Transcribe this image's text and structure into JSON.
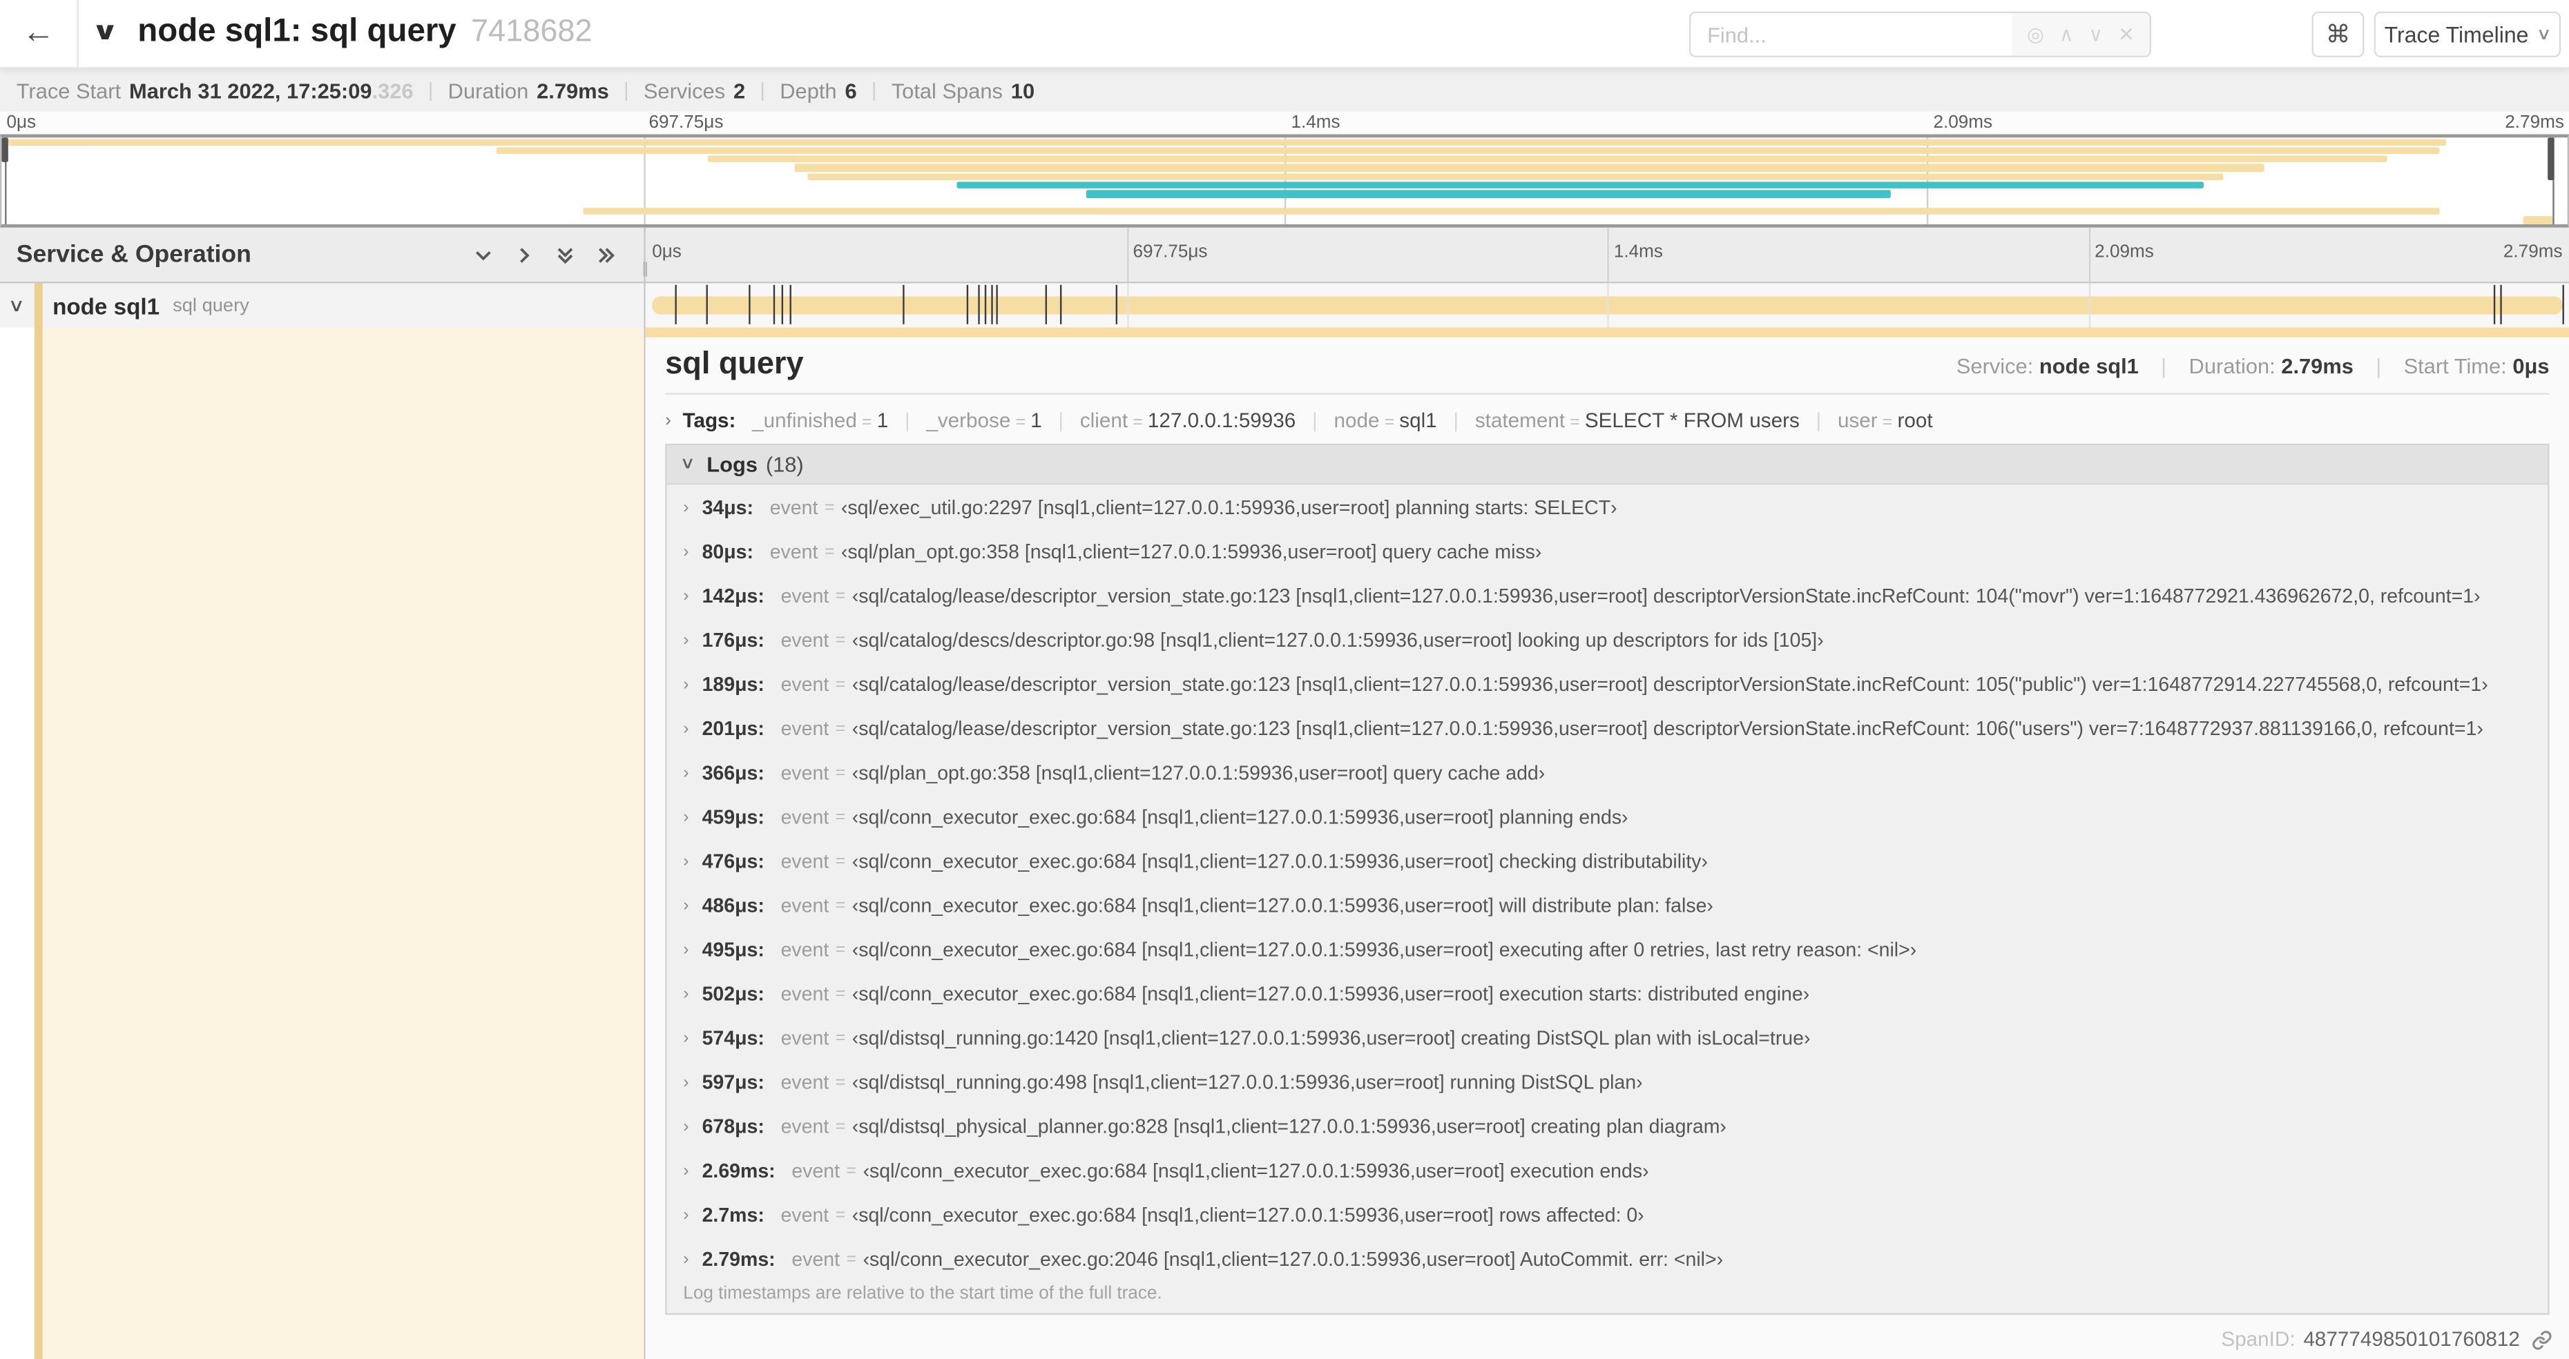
{
  "colors": {
    "tan": "#f6dda4",
    "tan_strip": "#eccf93",
    "cream": "#fcf3e0",
    "teal": "#3fc1c6"
  },
  "header": {
    "back": "←",
    "collapse_chevron": "∨",
    "title": "node sql1: sql query",
    "trace_id": "7418682",
    "find_placeholder": "Find...",
    "find_icons": [
      "◎",
      "∧",
      "∨",
      "✕"
    ],
    "shortcut_button": "⌘",
    "view_dropdown": "Trace Timeline",
    "view_dropdown_chevron": "∨"
  },
  "trace_info": {
    "start_label": "Trace Start",
    "start_value": "March 31 2022, 17:25:09",
    "start_suffix": ".326",
    "duration_label": "Duration",
    "duration_value": "2.79ms",
    "services_label": "Services",
    "services_value": "2",
    "depth_label": "Depth",
    "depth_value": "6",
    "spans_label": "Total Spans",
    "spans_value": "10",
    "separator": "|"
  },
  "timeline": {
    "total_us": 2790,
    "ticks": [
      {
        "label": "0μs",
        "pos": 0
      },
      {
        "label": "697.75μs",
        "pos": 25
      },
      {
        "label": "1.4ms",
        "pos": 50
      },
      {
        "label": "2.09ms",
        "pos": 75
      },
      {
        "label": "2.79ms",
        "pos": 100
      }
    ],
    "gridlines": [
      25,
      50,
      75
    ]
  },
  "minimap": {
    "spans": [
      {
        "row": 0,
        "start": 0,
        "end": 95.3,
        "color": "tan"
      },
      {
        "row": 1,
        "start": 19.3,
        "end": 95.0,
        "color": "tan"
      },
      {
        "row": 2,
        "start": 27.5,
        "end": 93.0,
        "color": "tan"
      },
      {
        "row": 3,
        "start": 30.9,
        "end": 88.2,
        "color": "tan"
      },
      {
        "row": 4,
        "start": 31.4,
        "end": 86.6,
        "color": "tan"
      },
      {
        "row": 5,
        "start": 37.2,
        "end": 85.8,
        "color": "teal"
      },
      {
        "row": 6,
        "start": 42.3,
        "end": 73.6,
        "color": "teal"
      },
      {
        "row": 8,
        "start": 22.7,
        "end": 95.0,
        "color": "tan"
      },
      {
        "row": 9,
        "start": 98.3,
        "end": 99.4,
        "color": "tan"
      }
    ]
  },
  "left_panel": {
    "header": "Service & Operation",
    "grip": "∥",
    "row": {
      "chevron": "∨",
      "service": "node sql1",
      "operation": "sql query"
    }
  },
  "detail": {
    "operation_title": "sql query",
    "service_label": "Service:",
    "service_value": "node sql1",
    "duration_label": "Duration:",
    "duration_value": "2.79ms",
    "start_label": "Start Time:",
    "start_value": "0μs",
    "meta_separator": "|",
    "tags_chevron": "›",
    "tags_label": "Tags:",
    "tags": [
      {
        "key": "_unfinished",
        "value": "1"
      },
      {
        "key": "_verbose",
        "value": "1"
      },
      {
        "key": "client",
        "value": "127.0.0.1:59936"
      },
      {
        "key": "node",
        "value": "sql1"
      },
      {
        "key": "statement",
        "value": "SELECT * FROM users"
      },
      {
        "key": "user",
        "value": "root"
      }
    ],
    "logs_chevron": "∨",
    "logs_label": "Logs",
    "logs_count": "(18)",
    "log_field": "event",
    "logs": [
      {
        "time": "34μs:",
        "t_us": 34,
        "value": "‹sql/exec_util.go:2297 [nsql1,client=127.0.0.1:59936,user=root] planning starts: SELECT›"
      },
      {
        "time": "80μs:",
        "t_us": 80,
        "value": "‹sql/plan_opt.go:358 [nsql1,client=127.0.0.1:59936,user=root] query cache miss›"
      },
      {
        "time": "142μs:",
        "t_us": 142,
        "value": "‹sql/catalog/lease/descriptor_version_state.go:123 [nsql1,client=127.0.0.1:59936,user=root] descriptorVersionState.incRefCount: 104(\"movr\") ver=1:1648772921.436962672,0, refcount=1›"
      },
      {
        "time": "176μs:",
        "t_us": 176,
        "value": "‹sql/catalog/descs/descriptor.go:98 [nsql1,client=127.0.0.1:59936,user=root] looking up descriptors for ids [105]›"
      },
      {
        "time": "189μs:",
        "t_us": 189,
        "value": "‹sql/catalog/lease/descriptor_version_state.go:123 [nsql1,client=127.0.0.1:59936,user=root] descriptorVersionState.incRefCount: 105(\"public\") ver=1:1648772914.227745568,0, refcount=1›"
      },
      {
        "time": "201μs:",
        "t_us": 201,
        "value": "‹sql/catalog/lease/descriptor_version_state.go:123 [nsql1,client=127.0.0.1:59936,user=root] descriptorVersionState.incRefCount: 106(\"users\") ver=7:1648772937.881139166,0, refcount=1›"
      },
      {
        "time": "366μs:",
        "t_us": 366,
        "value": "‹sql/plan_opt.go:358 [nsql1,client=127.0.0.1:59936,user=root] query cache add›"
      },
      {
        "time": "459μs:",
        "t_us": 459,
        "value": "‹sql/conn_executor_exec.go:684 [nsql1,client=127.0.0.1:59936,user=root] planning ends›"
      },
      {
        "time": "476μs:",
        "t_us": 476,
        "value": "‹sql/conn_executor_exec.go:684 [nsql1,client=127.0.0.1:59936,user=root] checking distributability›"
      },
      {
        "time": "486μs:",
        "t_us": 486,
        "value": "‹sql/conn_executor_exec.go:684 [nsql1,client=127.0.0.1:59936,user=root] will distribute plan: false›"
      },
      {
        "time": "495μs:",
        "t_us": 495,
        "value": "‹sql/conn_executor_exec.go:684 [nsql1,client=127.0.0.1:59936,user=root] executing after 0 retries, last retry reason: <nil>›"
      },
      {
        "time": "502μs:",
        "t_us": 502,
        "value": "‹sql/conn_executor_exec.go:684 [nsql1,client=127.0.0.1:59936,user=root] execution starts: distributed engine›"
      },
      {
        "time": "574μs:",
        "t_us": 574,
        "value": "‹sql/distsql_running.go:1420 [nsql1,client=127.0.0.1:59936,user=root] creating DistSQL plan with isLocal=true›"
      },
      {
        "time": "597μs:",
        "t_us": 597,
        "value": "‹sql/distsql_running.go:498 [nsql1,client=127.0.0.1:59936,user=root] running DistSQL plan›"
      },
      {
        "time": "678μs:",
        "t_us": 678,
        "value": "‹sql/distsql_physical_planner.go:828 [nsql1,client=127.0.0.1:59936,user=root] creating plan diagram›"
      },
      {
        "time": "2.69ms:",
        "t_us": 2690,
        "value": "‹sql/conn_executor_exec.go:684 [nsql1,client=127.0.0.1:59936,user=root] execution ends›"
      },
      {
        "time": "2.7ms:",
        "t_us": 2700,
        "value": "‹sql/conn_executor_exec.go:684 [nsql1,client=127.0.0.1:59936,user=root] rows affected: 0›"
      },
      {
        "time": "2.79ms:",
        "t_us": 2790,
        "value": "‹sql/conn_executor_exec.go:2046 [nsql1,client=127.0.0.1:59936,user=root] AutoCommit. err: <nil>›"
      }
    ],
    "footer_note": "Log timestamps are relative to the start time of the full trace.",
    "span_id_label": "SpanID:",
    "span_id_value": "4877749850101760812"
  }
}
